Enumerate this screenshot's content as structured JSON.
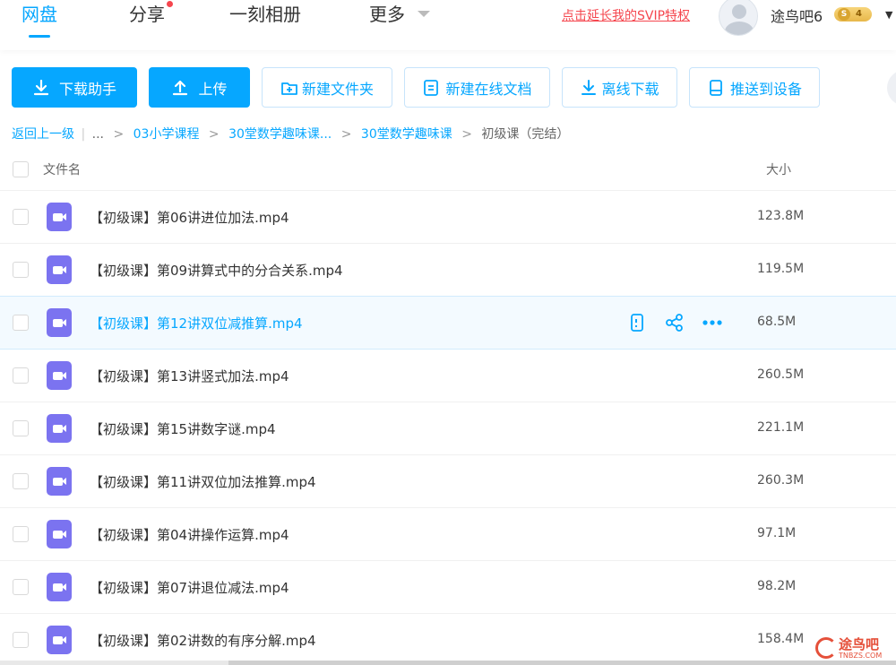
{
  "nav": {
    "tabs": [
      {
        "label": "网盘",
        "active": true
      },
      {
        "label": "分享",
        "has_dot": true
      },
      {
        "label": "一刻相册"
      },
      {
        "label": "更多",
        "has_caret": true
      }
    ],
    "svip_link": "点击延长我的SVIP特权",
    "user": {
      "name": "途鸟吧6",
      "vip_level": "4",
      "vip_symbol": "S"
    }
  },
  "toolbar": {
    "download_helper": "下载助手",
    "upload": "上传",
    "new_folder": "新建文件夹",
    "new_doc": "新建在线文档",
    "offline_download": "离线下载",
    "push_device": "推送到设备"
  },
  "breadcrumb": {
    "back": "返回上一级",
    "divider": "|",
    "ellipsis": "...",
    "items": [
      "03小学课程",
      "30堂数学趣味课...",
      "30堂数学趣味课"
    ],
    "current": "初级课（完结）",
    "sep": ">"
  },
  "table": {
    "col_name": "文件名",
    "col_size": "大小",
    "rows": [
      {
        "name": "【初级课】第06讲进位加法.mp4",
        "size": "123.8M"
      },
      {
        "name": "【初级课】第09讲算式中的分合关系.mp4",
        "size": "119.5M"
      },
      {
        "name": "【初级课】第12讲双位减推算.mp4",
        "size": "68.5M",
        "hover": true
      },
      {
        "name": "【初级课】第13讲竖式加法.mp4",
        "size": "260.5M"
      },
      {
        "name": "【初级课】第15讲数字谜.mp4",
        "size": "221.1M"
      },
      {
        "name": "【初级课】第11讲双位加法推算.mp4",
        "size": "260.3M"
      },
      {
        "name": "【初级课】第04讲操作运算.mp4",
        "size": "97.1M"
      },
      {
        "name": "【初级课】第07讲退位减法.mp4",
        "size": "98.2M"
      },
      {
        "name": "【初级课】第02讲数的有序分解.mp4",
        "size": "158.4M"
      }
    ]
  },
  "watermark": {
    "text": "途鸟吧",
    "sub": "TNBZS.COM"
  },
  "colors": {
    "accent": "#06a7ff",
    "video_icon": "#7b73f0",
    "svip_red": "#f5464e"
  }
}
